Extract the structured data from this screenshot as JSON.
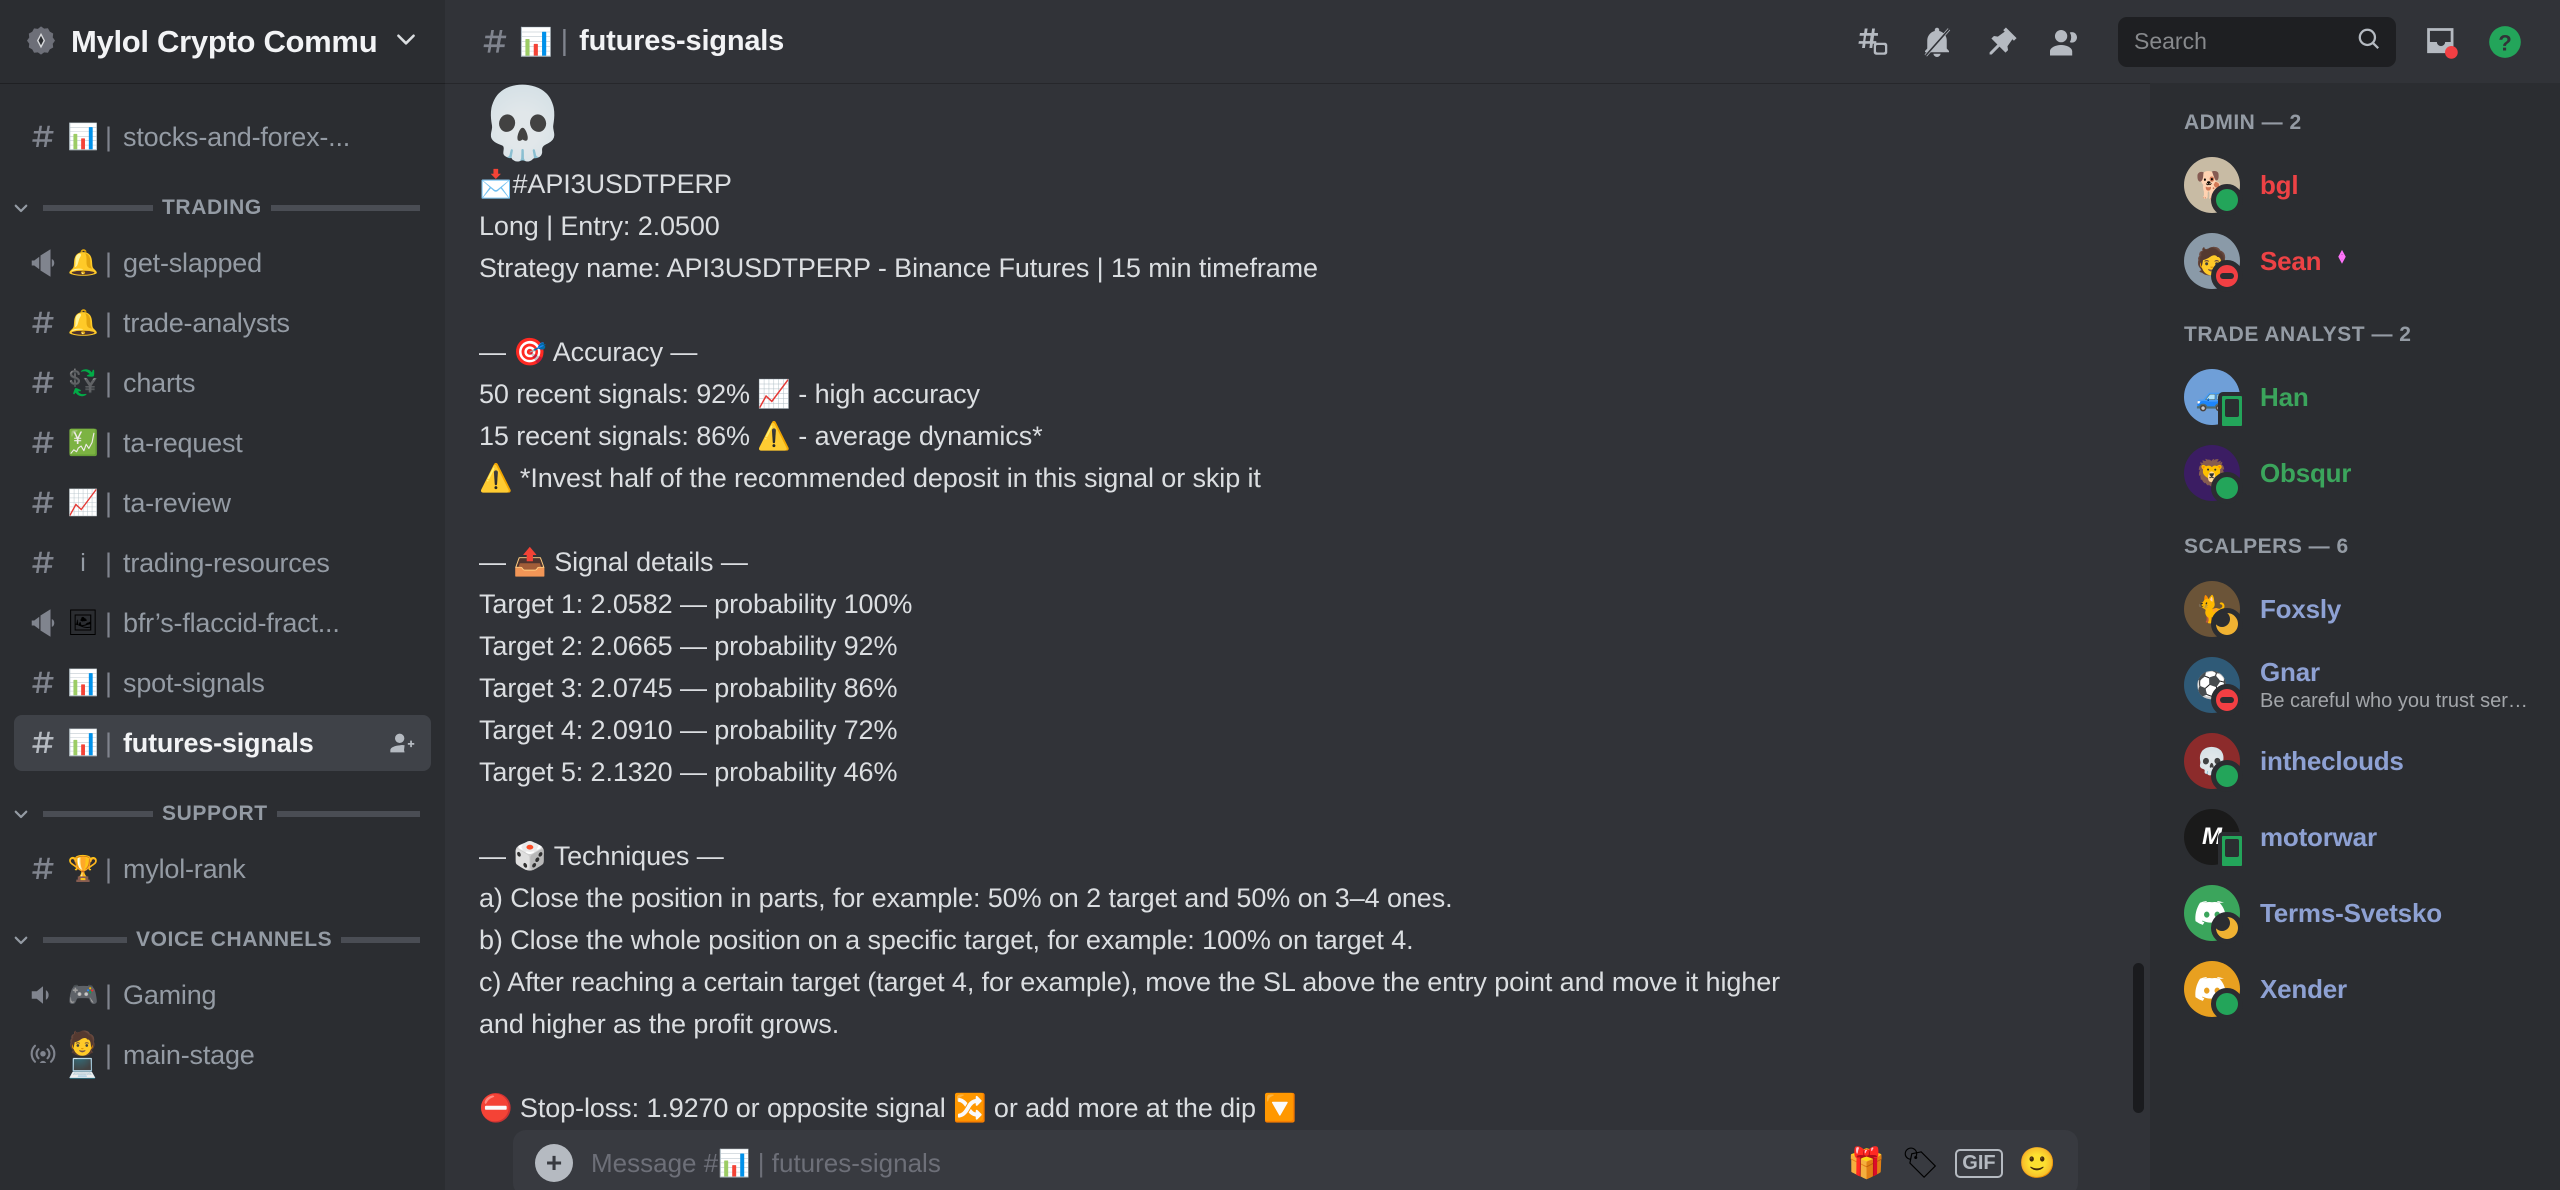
{
  "server": {
    "name": "Mylol Crypto Commu...",
    "badge_icon": "verified-server-icon",
    "chevron_icon": "chevron-down-icon"
  },
  "sidebar": {
    "ungrouped_channels": [
      {
        "type": "text",
        "emoji": "📊",
        "name": "stocks-and-forex-...",
        "active": false
      }
    ],
    "categories": [
      {
        "name": "TRADING",
        "channels": [
          {
            "type": "announcement",
            "emoji": "🔔",
            "name": "get-slapped",
            "active": false
          },
          {
            "type": "text",
            "emoji": "🔔",
            "name": "trade-analysts",
            "active": false
          },
          {
            "type": "text",
            "emoji": "💱",
            "name": "charts",
            "active": false
          },
          {
            "type": "text",
            "emoji": "💹",
            "name": "ta-request",
            "active": false
          },
          {
            "type": "text",
            "emoji": "📈",
            "name": "ta-review",
            "active": false
          },
          {
            "type": "text",
            "emoji": "i",
            "name": "trading-resources",
            "active": false
          },
          {
            "type": "announcement",
            "emoji": "🖼",
            "name": "bfr’s-flaccid-fract...",
            "active": false
          },
          {
            "type": "text",
            "emoji": "📊",
            "name": "spot-signals",
            "active": false
          },
          {
            "type": "text",
            "emoji": "📊",
            "name": "futures-signals",
            "active": true,
            "invite_icon": "add-member-icon"
          }
        ]
      },
      {
        "name": "SUPPORT",
        "channels": [
          {
            "type": "text",
            "emoji": "🏆",
            "name": "mylol-rank",
            "active": false
          }
        ]
      },
      {
        "name": "VOICE CHANNELS",
        "channels": [
          {
            "type": "voice",
            "emoji": "🎮",
            "name": "Gaming",
            "active": false
          },
          {
            "type": "stage",
            "emoji": "🧑💻",
            "name": "main-stage",
            "active": false
          }
        ]
      }
    ]
  },
  "topbar": {
    "channel_emoji": "📊",
    "channel_name": "futures-signals",
    "icons": [
      {
        "name": "threads-icon"
      },
      {
        "name": "bell-muted-icon"
      },
      {
        "name": "pin-icon"
      },
      {
        "name": "members-icon"
      }
    ],
    "search": {
      "placeholder": "Search",
      "icon": "search-icon"
    },
    "inbox_icon": "inbox-icon",
    "help_icon": "help-icon"
  },
  "message": {
    "lines": [
      {
        "kind": "emoji",
        "text": "💀"
      },
      {
        "kind": "text",
        "text": "📩#API3USDTPERP"
      },
      {
        "kind": "text",
        "text": "Long | Entry: 2.0500"
      },
      {
        "kind": "text",
        "text": "Strategy name: API3USDTPERP - Binance Futures | 15 min timeframe"
      },
      {
        "kind": "blank",
        "text": ""
      },
      {
        "kind": "text",
        "text": "— 🎯 Accuracy —"
      },
      {
        "kind": "text",
        "text": "50 recent signals: 92% 📈 - high accuracy"
      },
      {
        "kind": "text",
        "text": "15 recent signals: 86% ⚠️ - average dynamics*"
      },
      {
        "kind": "text",
        "text": "⚠️ *Invest half of the recommended deposit in this signal or skip it"
      },
      {
        "kind": "blank",
        "text": ""
      },
      {
        "kind": "text",
        "text": "— 📤 Signal details —"
      },
      {
        "kind": "text",
        "text": "Target 1: 2.0582 — probability 100%"
      },
      {
        "kind": "text",
        "text": "Target 2: 2.0665 — probability 92%"
      },
      {
        "kind": "text",
        "text": "Target 3: 2.0745 — probability 86%"
      },
      {
        "kind": "text",
        "text": "Target 4: 2.0910 — probability 72%"
      },
      {
        "kind": "text",
        "text": "Target 5: 2.1320 — probability 46%"
      },
      {
        "kind": "blank",
        "text": ""
      },
      {
        "kind": "text",
        "text": "— 🎲 Techniques —"
      },
      {
        "kind": "text",
        "text": "a) Close the position in parts, for example: 50% on 2 target and 50% on 3–4 ones."
      },
      {
        "kind": "text",
        "text": "b) Close the whole position on a specific target, for example: 100% on target 4."
      },
      {
        "kind": "text",
        "text": "c) After reaching a certain target (target 4, for example), move the SL above the entry point and move it higher"
      },
      {
        "kind": "text",
        "text": "and higher as the profit grows."
      },
      {
        "kind": "blank",
        "text": ""
      },
      {
        "kind": "text",
        "text": "⛔ Stop-loss: 1.9270 or opposite signal 🔀 or add more at the dip 🔽"
      }
    ]
  },
  "composer": {
    "placeholder": "Message #📊 | futures-signals",
    "plus_label": "+",
    "icons": [
      {
        "name": "gift-icon",
        "glyph": "🎁"
      },
      {
        "name": "sticker-icon",
        "glyph": "🏷"
      },
      {
        "name": "gif-icon",
        "glyph": "GIF"
      },
      {
        "name": "emoji-picker-icon",
        "glyph": "🙂"
      }
    ]
  },
  "members": {
    "groups": [
      {
        "label": "ADMIN — 2",
        "people": [
          {
            "name": "bgl",
            "color": "#ed4245",
            "status": "online",
            "avatar_bg": "#c8bba4",
            "avatar_glyph": "🐕",
            "custom_status": "",
            "badge": ""
          },
          {
            "name": "Sean",
            "color": "#ed4245",
            "status": "dnd",
            "avatar_bg": "#8a9aa8",
            "avatar_glyph": "🧑",
            "custom_status": "",
            "badge": "boost-badge-icon"
          }
        ]
      },
      {
        "label": "TRADE ANALYST — 2",
        "people": [
          {
            "name": "Han",
            "color": "#3ba55c",
            "status": "mobile",
            "avatar_bg": "#6f9fd8",
            "avatar_glyph": "🚙",
            "custom_status": "",
            "badge": ""
          },
          {
            "name": "Obsqur",
            "color": "#3ba55c",
            "status": "online",
            "avatar_bg": "#3b1d63",
            "avatar_glyph": "🦁",
            "custom_status": "",
            "badge": ""
          }
        ]
      },
      {
        "label": "SCALPERS — 6",
        "people": [
          {
            "name": "Foxsly",
            "color": "#8ea1d3",
            "status": "idle",
            "avatar_bg": "#6b5438",
            "avatar_glyph": "🐈",
            "custom_status": "",
            "badge": ""
          },
          {
            "name": "Gnar",
            "color": "#8ea1d3",
            "status": "dnd",
            "avatar_bg": "#2f5a77",
            "avatar_glyph": "⚽",
            "custom_status": "Be careful who you trust serg...",
            "badge": ""
          },
          {
            "name": "intheclouds",
            "color": "#8ea1d3",
            "status": "online",
            "avatar_bg": "#8c2b2b",
            "avatar_glyph": "💀",
            "custom_status": "",
            "badge": ""
          },
          {
            "name": "motorwar",
            "color": "#8ea1d3",
            "status": "mobile",
            "avatar_bg": "#1a1a1a",
            "avatar_glyph": "Ⓜ",
            "custom_status": "",
            "badge": ""
          },
          {
            "name": "Terms-Svetsko",
            "color": "#8ea1d3",
            "status": "idle",
            "avatar_bg": "#3ba55c",
            "avatar_glyph": "🎮",
            "custom_status": "",
            "badge": ""
          },
          {
            "name": "Xender",
            "color": "#8ea1d3",
            "status": "online",
            "avatar_bg": "#e8a020",
            "avatar_glyph": "🎮",
            "custom_status": "",
            "badge": ""
          }
        ]
      }
    ]
  }
}
